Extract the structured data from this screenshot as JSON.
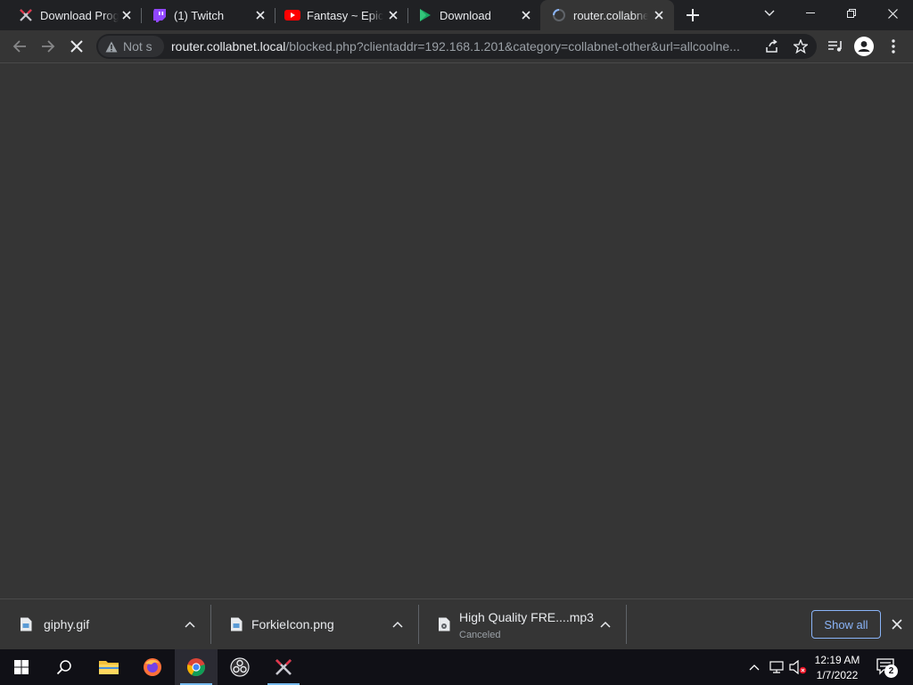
{
  "tabs": [
    {
      "title": "Download Prog",
      "favicon": "crossed-swords-icon",
      "active": false
    },
    {
      "title": "(1) Twitch",
      "favicon": "twitch-icon",
      "active": false
    },
    {
      "title": "Fantasy ~ Epic n",
      "favicon": "youtube-icon",
      "active": false
    },
    {
      "title": "Download",
      "favicon": "play-triangle-icon",
      "active": false
    },
    {
      "title": "router.collabnet",
      "favicon": "loading-spinner-icon",
      "active": true
    }
  ],
  "address_bar": {
    "security_label": "Not s",
    "url_host": "router.collabnet.local",
    "url_path": "/blocked.php?clientaddr=192.168.1.201&category=collabnet-other&url=allcoolne..."
  },
  "downloads": [
    {
      "name": "giphy.gif",
      "status": "",
      "icon": "image-file-icon"
    },
    {
      "name": "ForkieIcon.png",
      "status": "",
      "icon": "image-file-icon"
    },
    {
      "name": "High Quality FRE....mp3",
      "status": "Canceled",
      "icon": "audio-file-icon"
    }
  ],
  "downloads_bar": {
    "show_all_label": "Show all"
  },
  "taskbar": {
    "apps": [
      "start-icon",
      "search-icon",
      "file-explorer-icon",
      "firefox-icon",
      "chrome-icon",
      "obs-icon",
      "crossed-swords-app-icon"
    ],
    "clock_time": "12:19 AM",
    "clock_date": "1/7/2022",
    "notification_count": "2"
  },
  "colors": {
    "accent": "#8ab4f8",
    "tabstrip": "#202124",
    "page_bg": "#353535",
    "taskbar": "#101016"
  }
}
